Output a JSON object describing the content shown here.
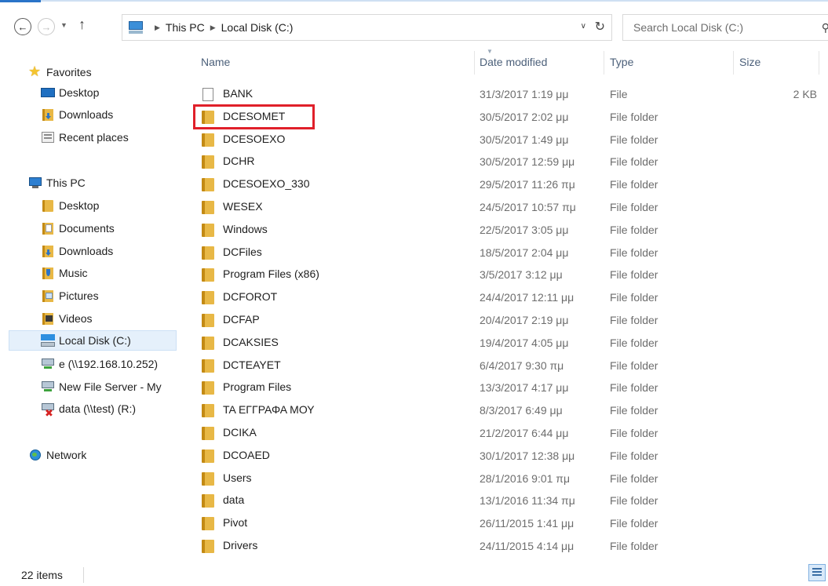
{
  "address_bar": {
    "breadcrumbs": [
      "This PC",
      "Local Disk (C:)"
    ],
    "search_placeholder": "Search Local Disk (C:)"
  },
  "nav_pane": {
    "items": [
      {
        "label": "Favorites",
        "icon": "star-icon",
        "top": 0
      },
      {
        "label": "Desktop",
        "icon": "desktop-icon"
      },
      {
        "label": "Downloads",
        "icon": "downloads-folder-icon"
      },
      {
        "label": "Recent places",
        "icon": "recent-places-icon"
      },
      {
        "label": "This PC",
        "icon": "computer-icon"
      },
      {
        "label": "Desktop",
        "icon": "desktop-folder-icon"
      },
      {
        "label": "Documents",
        "icon": "documents-folder-icon"
      },
      {
        "label": "Downloads",
        "icon": "downloads-folder-icon"
      },
      {
        "label": "Music",
        "icon": "music-folder-icon"
      },
      {
        "label": "Pictures",
        "icon": "pictures-folder-icon"
      },
      {
        "label": "Videos",
        "icon": "videos-folder-icon"
      },
      {
        "label": "Local Disk (C:)",
        "icon": "local-disk-icon"
      },
      {
        "label": "e (\\\\192.168.10.252)",
        "icon": "network-drive-icon"
      },
      {
        "label": "New File Server - My",
        "icon": "network-drive-icon"
      },
      {
        "label": "data (\\\\test) (R:)",
        "icon": "disconnected-drive-icon"
      },
      {
        "label": "Network",
        "icon": "network-icon"
      }
    ]
  },
  "columns": {
    "name": "Name",
    "date_modified": "Date modified",
    "type": "Type",
    "size": "Size"
  },
  "files": [
    {
      "name": "BANK",
      "date": "31/3/2017 1:19 μμ",
      "type": "File",
      "size": "2 KB",
      "kind": "file"
    },
    {
      "name": "DCESOMET",
      "date": "30/5/2017 2:02 μμ",
      "type": "File folder",
      "size": "",
      "kind": "folder"
    },
    {
      "name": "DCESOEXO",
      "date": "30/5/2017 1:49 μμ",
      "type": "File folder",
      "size": "",
      "kind": "folder"
    },
    {
      "name": "DCHR",
      "date": "30/5/2017 12:59 μμ",
      "type": "File folder",
      "size": "",
      "kind": "folder"
    },
    {
      "name": "DCESOEXO_330",
      "date": "29/5/2017 11:26 πμ",
      "type": "File folder",
      "size": "",
      "kind": "folder"
    },
    {
      "name": "WESEX",
      "date": "24/5/2017 10:57 πμ",
      "type": "File folder",
      "size": "",
      "kind": "folder"
    },
    {
      "name": "Windows",
      "date": "22/5/2017 3:05 μμ",
      "type": "File folder",
      "size": "",
      "kind": "folder"
    },
    {
      "name": "DCFiles",
      "date": "18/5/2017 2:04 μμ",
      "type": "File folder",
      "size": "",
      "kind": "folder"
    },
    {
      "name": "Program Files (x86)",
      "date": "3/5/2017 3:12 μμ",
      "type": "File folder",
      "size": "",
      "kind": "folder"
    },
    {
      "name": "DCFOROT",
      "date": "24/4/2017 12:11 μμ",
      "type": "File folder",
      "size": "",
      "kind": "folder"
    },
    {
      "name": "DCFAP",
      "date": "20/4/2017 2:19 μμ",
      "type": "File folder",
      "size": "",
      "kind": "folder"
    },
    {
      "name": "DCAKSIES",
      "date": "19/4/2017 4:05 μμ",
      "type": "File folder",
      "size": "",
      "kind": "folder"
    },
    {
      "name": "DCTEAYET",
      "date": "6/4/2017 9:30 πμ",
      "type": "File folder",
      "size": "",
      "kind": "folder"
    },
    {
      "name": "Program Files",
      "date": "13/3/2017 4:17 μμ",
      "type": "File folder",
      "size": "",
      "kind": "folder"
    },
    {
      "name": "ΤΑ ΕΓΓΡΑΦΑ ΜΟΥ",
      "date": "8/3/2017 6:49 μμ",
      "type": "File folder",
      "size": "",
      "kind": "folder"
    },
    {
      "name": "DCIKA",
      "date": "21/2/2017 6:44 μμ",
      "type": "File folder",
      "size": "",
      "kind": "folder"
    },
    {
      "name": "DCOAED",
      "date": "30/1/2017 12:38 μμ",
      "type": "File folder",
      "size": "",
      "kind": "folder"
    },
    {
      "name": "Users",
      "date": "28/1/2016 9:01 πμ",
      "type": "File folder",
      "size": "",
      "kind": "folder"
    },
    {
      "name": "data",
      "date": "13/1/2016 11:34 πμ",
      "type": "File folder",
      "size": "",
      "kind": "folder"
    },
    {
      "name": "Pivot",
      "date": "26/11/2015 1:41 μμ",
      "type": "File folder",
      "size": "",
      "kind": "folder"
    },
    {
      "name": "Drivers",
      "date": "24/11/2015 4:14 μμ",
      "type": "File folder",
      "size": "",
      "kind": "folder"
    }
  ],
  "status_bar": {
    "item_count": "22 items"
  },
  "colors": {
    "accent": "#2a74c8",
    "selection": "#e5f0fb",
    "highlight": "#e0202a",
    "folder": "#e8b846"
  }
}
